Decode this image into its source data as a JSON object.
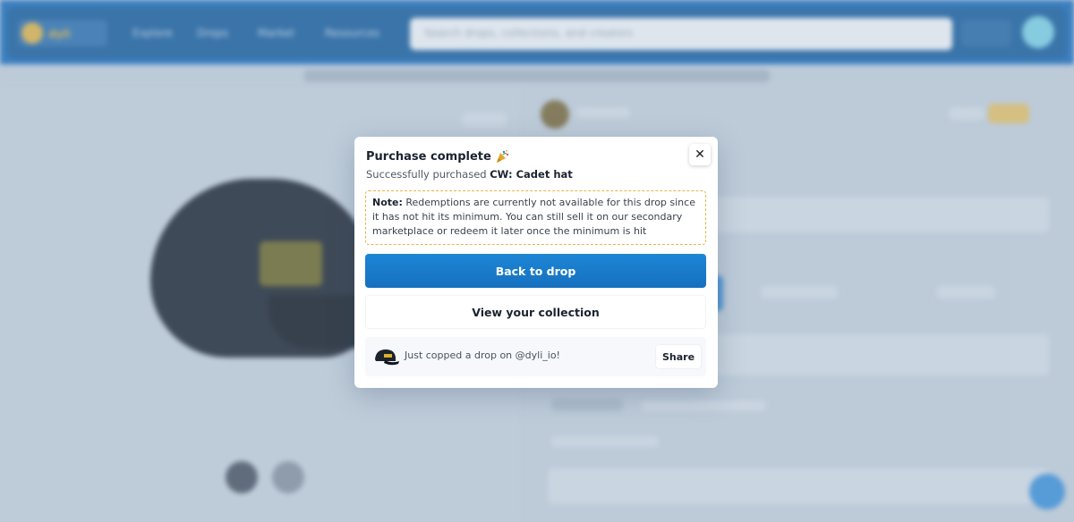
{
  "header": {
    "logo_text": "dyli",
    "nav": [
      "Explore",
      "Drops",
      "Market",
      "Resources"
    ],
    "search_placeholder": "Search drops, collections, and creators"
  },
  "modal": {
    "title": "Purchase complete",
    "subtitle_prefix": "Successfully purchased ",
    "product_name": "CW: Cadet hat",
    "note_label": "Note:",
    "note_text": " Redemptions are currently not available for this drop since it has not hit its minimum. You can still sell it on our secondary marketplace or redeem it later once the minimum is hit",
    "primary_button": "Back to drop",
    "secondary_button": "View your collection",
    "share_text": "Just copped a drop on @dyli_io!",
    "share_button": "Share"
  },
  "colors": {
    "primary": "#1a7cd0",
    "note_border": "#e6b34c",
    "header_blue": "#1a6dbf"
  },
  "icons": {
    "close": "close-icon",
    "party": "party-popper-icon"
  }
}
